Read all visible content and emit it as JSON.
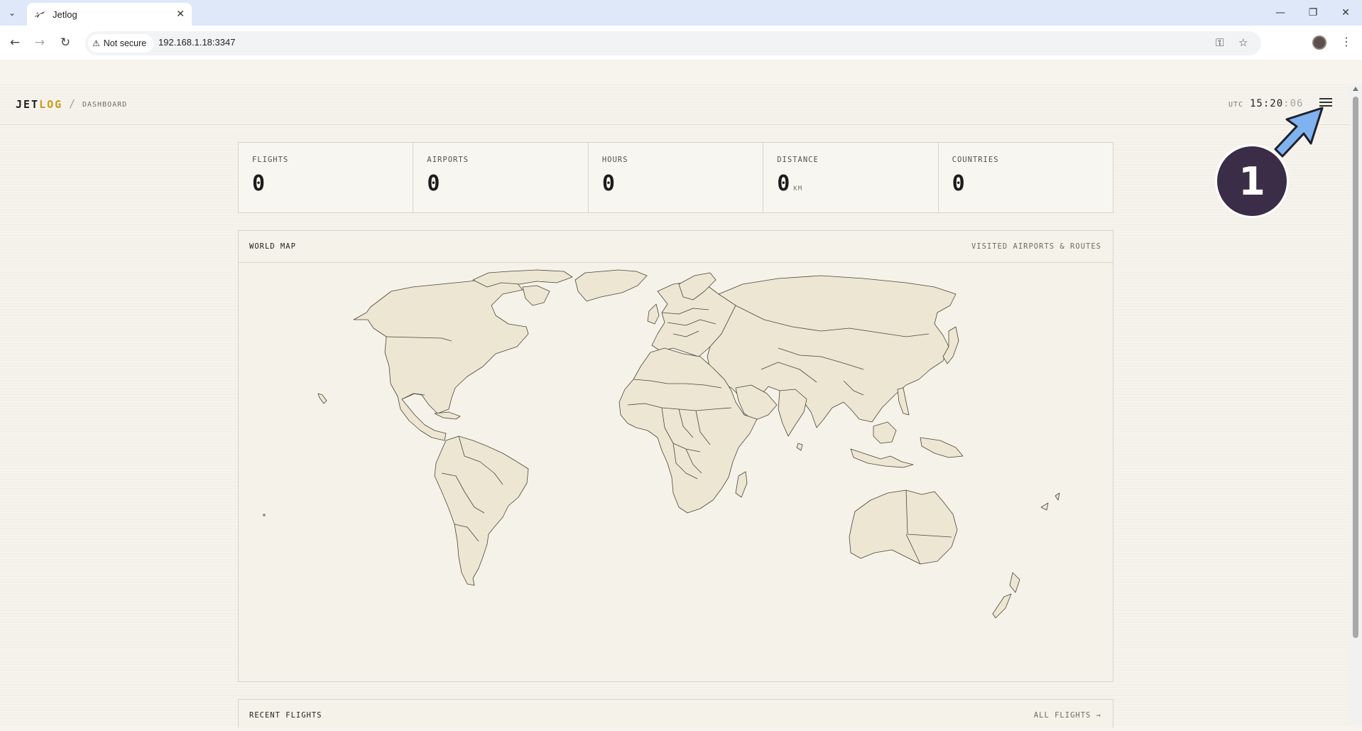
{
  "browser": {
    "tab_title": "Jetlog",
    "security_label": "Not secure",
    "url": "192.168.1.18:3347"
  },
  "app": {
    "brand_first": "JET",
    "brand_second": "LOG",
    "breadcrumb_separator": "/",
    "breadcrumb": "DASHBOARD",
    "utc_label": "UTC",
    "utc_time": "15:20",
    "utc_seconds": ":06",
    "accent_color": "#c99a17"
  },
  "stats": [
    {
      "label": "FLIGHTS",
      "value": "0",
      "unit": ""
    },
    {
      "label": "AIRPORTS",
      "value": "0",
      "unit": ""
    },
    {
      "label": "HOURS",
      "value": "0",
      "unit": ""
    },
    {
      "label": "DISTANCE",
      "value": "0",
      "unit": "KM"
    },
    {
      "label": "COUNTRIES",
      "value": "0",
      "unit": ""
    }
  ],
  "world_map": {
    "title": "WORLD MAP",
    "subtitle": "VISITED AIRPORTS & ROUTES"
  },
  "recent_flights": {
    "title": "RECENT FLIGHTS",
    "link": "ALL FLIGHTS →"
  },
  "annotation": {
    "step_number": "1"
  }
}
